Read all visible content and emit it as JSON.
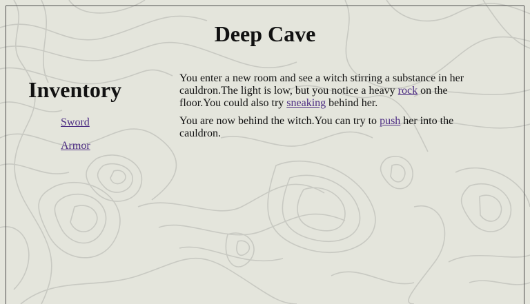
{
  "page": {
    "title": "Deep Cave"
  },
  "inventory": {
    "heading": "Inventory",
    "items": [
      {
        "label": "Sword"
      },
      {
        "label": "Armor"
      }
    ]
  },
  "story": {
    "p1": {
      "text1": "You enter a new room and see a witch stirring a substance in her cauldron.The light is low, but you notice a heavy ",
      "link1": "rock",
      "text2": " on the floor.You could also try ",
      "link2": "sneaking",
      "text3": " behind her."
    },
    "p2": {
      "text1": "You are now behind the witch.You can try to ",
      "link1": "push",
      "text2": " her into the cauldron."
    }
  },
  "colors": {
    "background": "#e4e5dc",
    "contour_lines": "#c8c9c2",
    "link": "#4b2a82",
    "text": "#111111",
    "frame_border": "#4a4a4a"
  }
}
